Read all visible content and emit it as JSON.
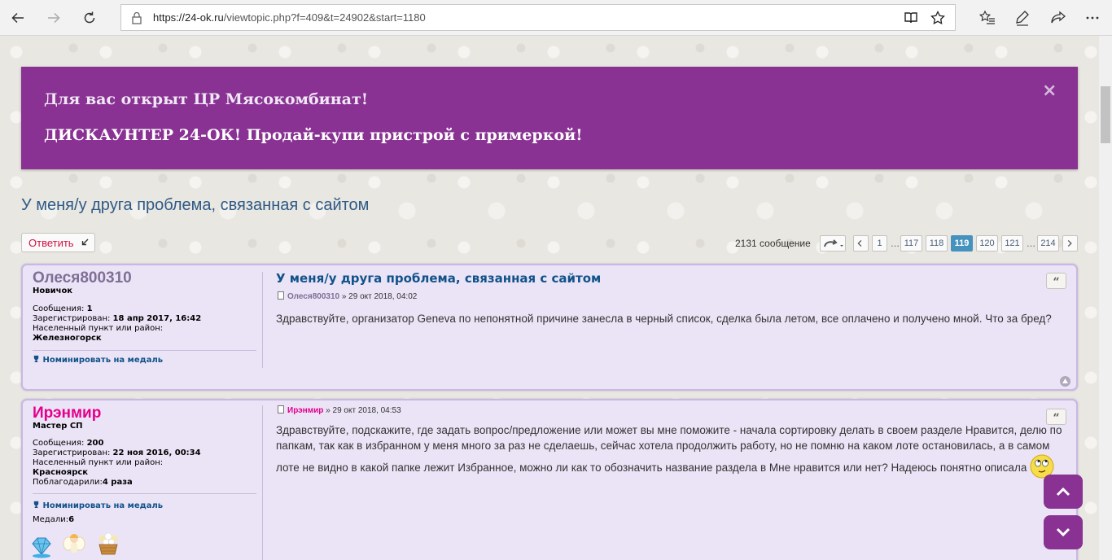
{
  "browser": {
    "url_host": "https://24-ok.ru",
    "url_path": "/viewtopic.php?f=409&t=24902&start=1180"
  },
  "banner": {
    "line1": "Для вас открыт ЦР Мясокомбинат!",
    "line2": "ДИСКАУНТЕР 24-ОК! Продай-купи пристрой с примеркой!",
    "close": "×"
  },
  "topic": {
    "title": "У меня/у друга проблема, связанная с сайтом",
    "reply_label": "Ответить",
    "message_count": "2131 сообщение"
  },
  "pagination": {
    "pages": [
      "1",
      "117",
      "118",
      "119",
      "120",
      "121",
      "214"
    ],
    "current": "119",
    "ellipsis": "…"
  },
  "posts": [
    {
      "author": "Олеся800310",
      "author_color": "#7e6f96",
      "rank": "Новичок",
      "messages_label": "Сообщения:",
      "messages": "1",
      "registered_label": "Зарегистрирован:",
      "registered": "18 апр 2017, 16:42",
      "location_label": "Населенный пункт или район:",
      "location": "Железногорск",
      "medal_link": "Номинировать на медаль",
      "title": "У меня/у друга проблема, связанная с сайтом",
      "meta_author": "Олеся800310",
      "meta_date": "» 29 окт 2018, 04:02",
      "body": "Здравствуйте, организатор Geneva по непонятной причине занесла в черный список, сделка была летом, все оплачено и получено мной. Что за бред?"
    },
    {
      "author": "Ирэнмир",
      "author_color": "#e4008c",
      "rank": "Мастер СП",
      "messages_label": "Сообщения:",
      "messages": "200",
      "registered_label": "Зарегистрирован:",
      "registered": "22 ноя 2016, 00:34",
      "location_label": "Населенный пункт или район:",
      "location": "Красноярск",
      "thanks_label": "Поблагодарили:",
      "thanks": "4 раза",
      "medal_link": "Номинировать на медаль",
      "medals_label": "Медали:",
      "medals": "6",
      "meta_author": "Ирэнмир",
      "meta_date": "» 29 окт 2018, 04:53",
      "body": "Здравствуйте, подскажите, где задать вопрос/предложение или может вы мне поможите - начала сортировку делать в своем разделе Нравится, делю по папкам, так как в избранном у меня много за раз не сделаешь, сейчас хотела продолжить работу, но не помню на каком лоте остановилась, а в самом лоте не видно в какой папке лежит Избранное, можно ли как то обозначить название раздела в Мне нравится или нет? Надеюсь понятно описала"
    }
  ],
  "colors": {
    "banner_bg": "#893293",
    "post_bg": "#ebe3f6",
    "link": "#105289",
    "active_page": "#4692bf"
  }
}
